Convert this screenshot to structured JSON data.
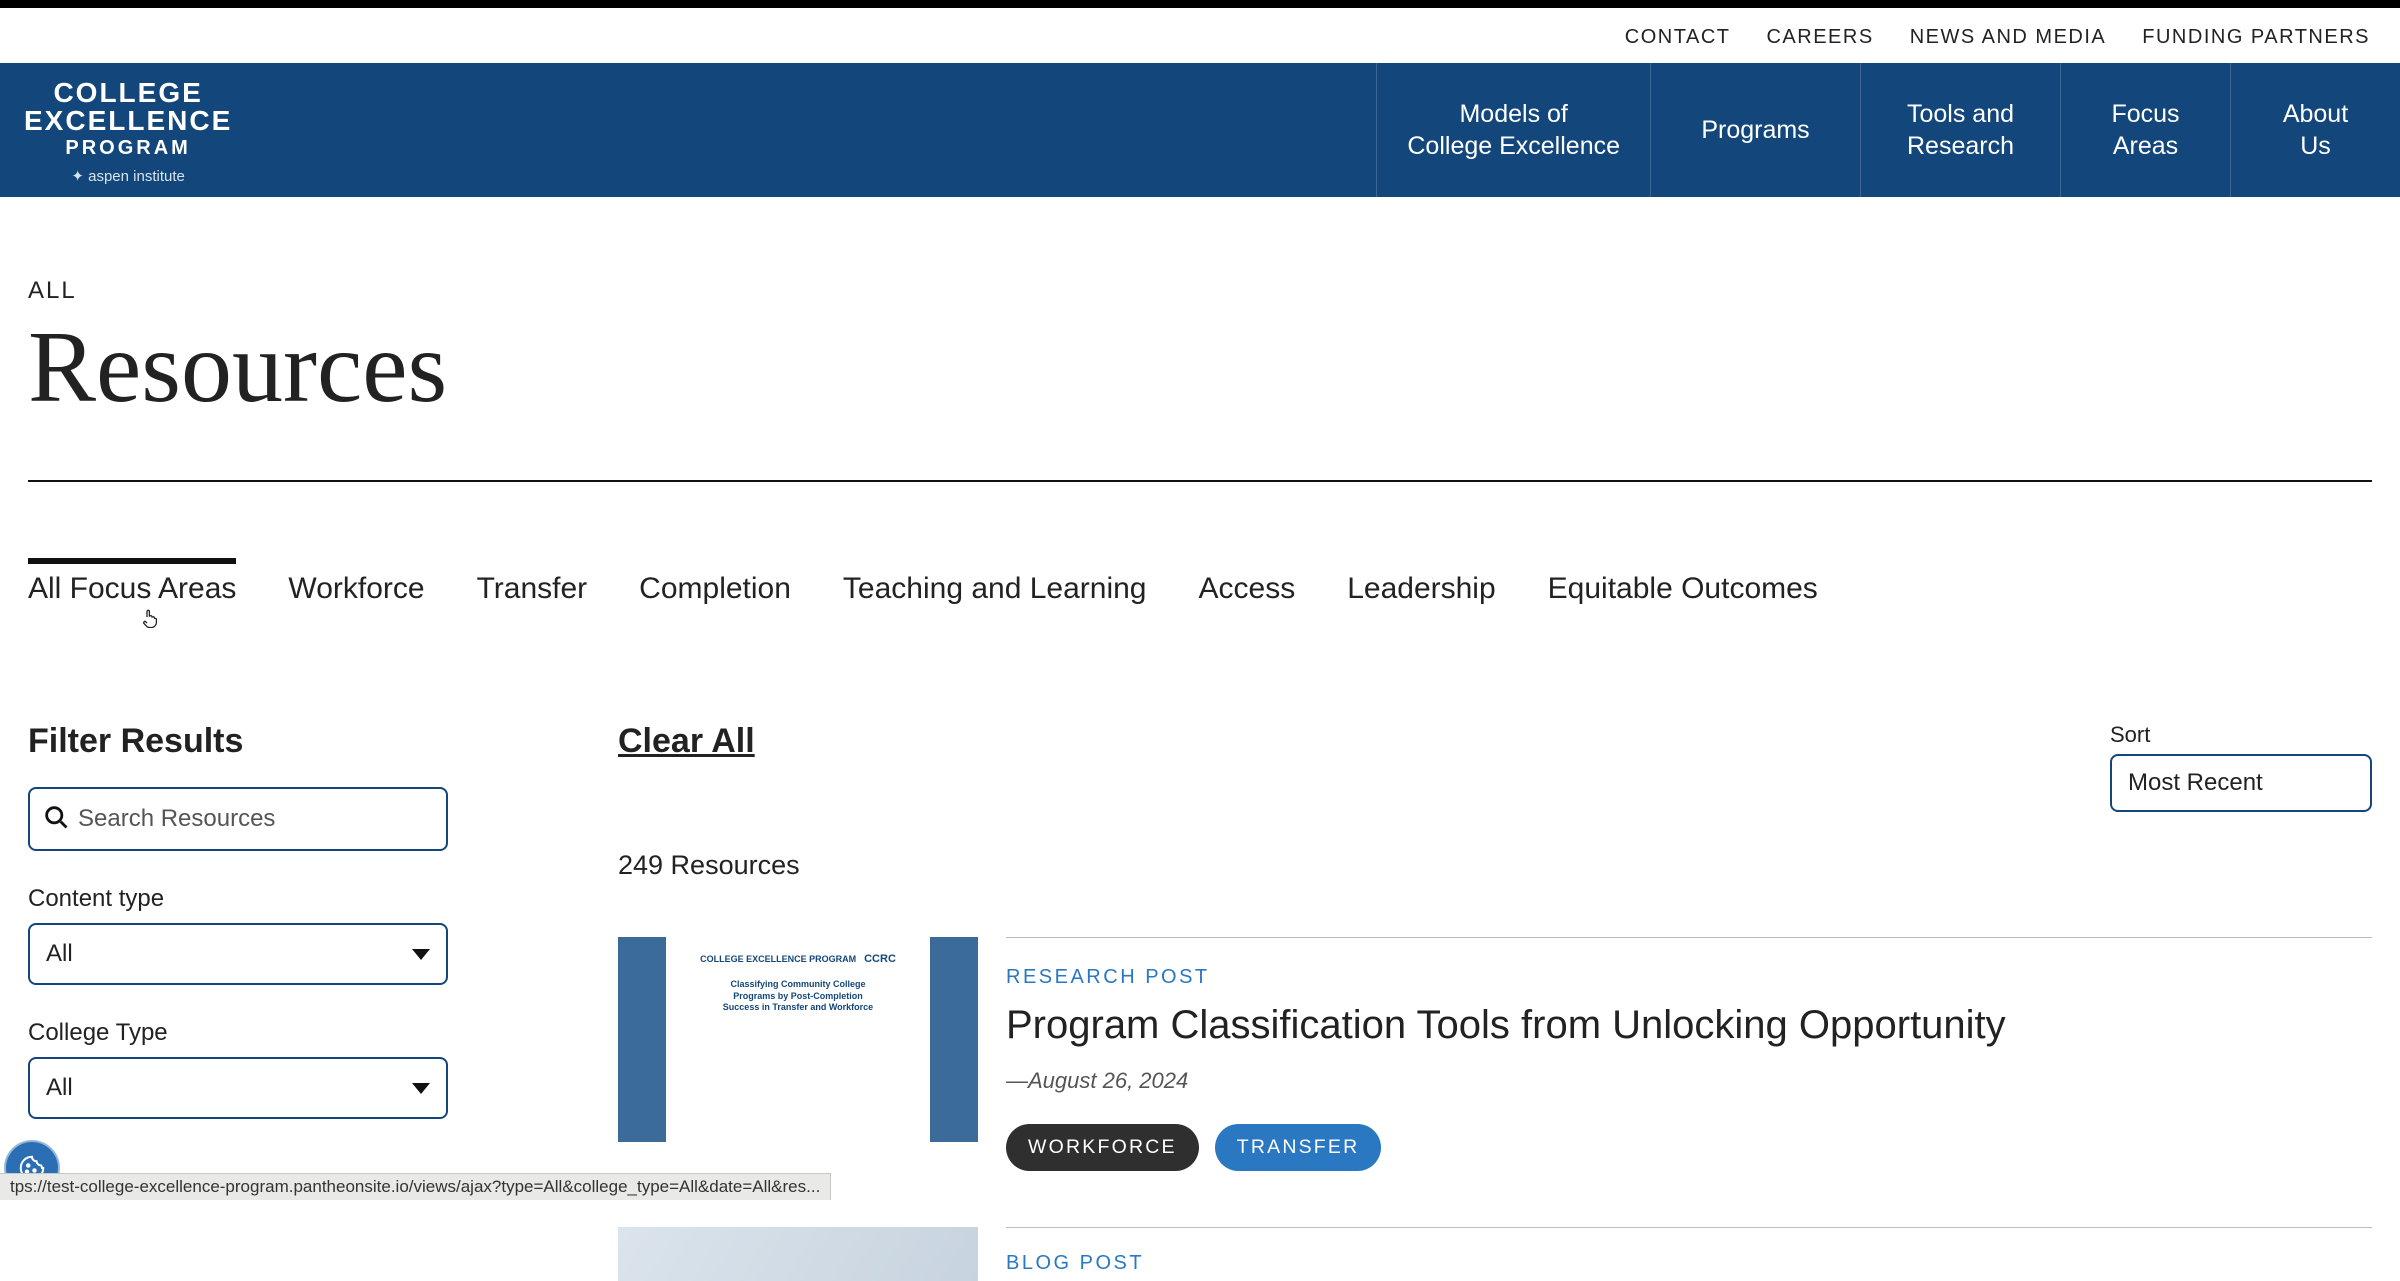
{
  "utility_nav": [
    "CONTACT",
    "CAREERS",
    "NEWS AND MEDIA",
    "FUNDING PARTNERS"
  ],
  "logo": {
    "line1": "COLLEGE",
    "line2": "EXCELLENCE",
    "line3": "PROGRAM",
    "sub": "✦ aspen institute"
  },
  "main_nav": [
    "Models of\nCollege Excellence",
    "Programs",
    "Tools and\nResearch",
    "Focus\nAreas",
    "About\nUs"
  ],
  "page": {
    "eyebrow": "ALL",
    "title": "Resources"
  },
  "focus_tabs": [
    "All Focus Areas",
    "Workforce",
    "Transfer",
    "Completion",
    "Teaching and Learning",
    "Access",
    "Leadership",
    "Equitable Outcomes"
  ],
  "filters": {
    "heading": "Filter Results",
    "search_placeholder": "Search Resources",
    "content_type": {
      "label": "Content type",
      "value": "All"
    },
    "college_type": {
      "label": "College Type",
      "value": "All"
    }
  },
  "results": {
    "clear_all": "Clear All",
    "sort_label": "Sort",
    "sort_value": "Most Recent",
    "count": "249 Resources"
  },
  "cards": [
    {
      "kicker": "RESEARCH POST",
      "title": "Program Classification Tools from Unlocking Opportunity",
      "date": "—August 26, 2024",
      "tags": [
        {
          "label": "WORKFORCE",
          "variant": "dark"
        },
        {
          "label": "TRANSFER",
          "variant": "blue"
        }
      ]
    },
    {
      "kicker": "BLOG POST"
    }
  ],
  "thumb_text": {
    "brand1": "COLLEGE\nEXCELLENCE\nPROGRAM",
    "brand2": "CCRC",
    "line1": "Classifying Community College",
    "line2": "Programs by Post-Completion",
    "line3": "Success in Transfer and Workforce"
  },
  "status_url": "tps://test-college-excellence-program.pantheonsite.io/views/ajax?type=All&college_type=All&date=All&res..."
}
